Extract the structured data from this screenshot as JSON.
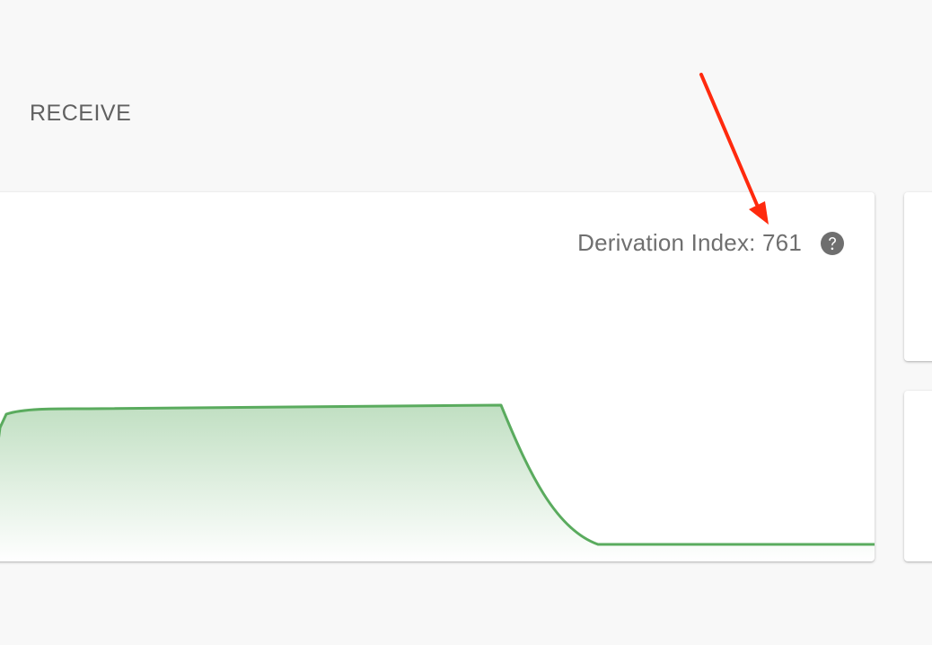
{
  "tabs": {
    "receive_label": "RECEIVE"
  },
  "receive_card": {
    "derivation_label": "Derivation Index: 761",
    "help_icon": "question-circle-icon"
  },
  "colors": {
    "background": "#f8f8f8",
    "card": "#ffffff",
    "chart_line": "#5aab5e",
    "text_secondary": "#6f6f6f",
    "annotation_arrow": "#ff2a0e"
  }
}
